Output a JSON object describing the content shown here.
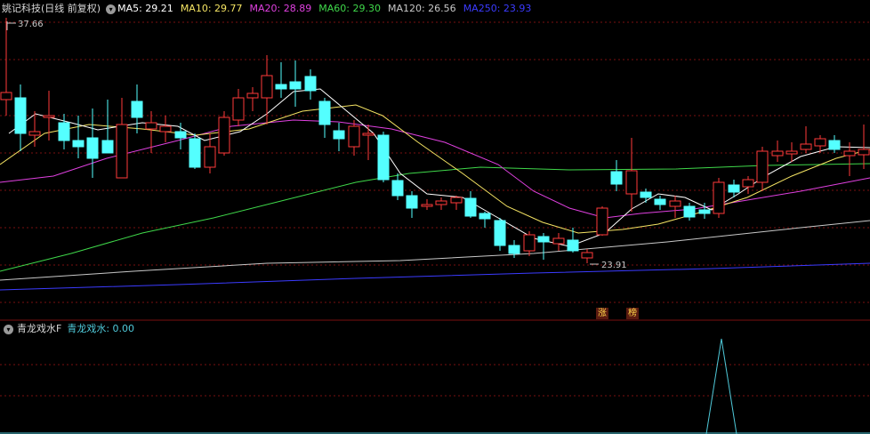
{
  "header": {
    "title": "姚记科技(日线 前复权)",
    "ma": [
      {
        "label": "MA5: 29.21",
        "color": "#ffffff"
      },
      {
        "label": "MA10: 29.77",
        "color": "#f5e463"
      },
      {
        "label": "MA20: 28.89",
        "color": "#e040e0"
      },
      {
        "label": "MA60: 29.30",
        "color": "#3fd84a"
      },
      {
        "label": "MA120: 26.56",
        "color": "#c8c8c8"
      },
      {
        "label": "MA250: 23.93",
        "color": "#3b3bff"
      }
    ]
  },
  "annotations": {
    "high": "37.66",
    "low": "23.91"
  },
  "tags": [
    "涨",
    "榜"
  ],
  "indicator": {
    "name": "青龙戏水F",
    "value_label": "青龙戏水: 0.00"
  },
  "colors": {
    "up": "#ff3a3a",
    "down": "#54ffff",
    "grid": "#7a1010",
    "ma5": "#ffffff",
    "ma10": "#f5e463",
    "ma20": "#e040e0",
    "ma60": "#3fd84a",
    "ma120": "#c8c8c8",
    "ma250": "#3b3bff",
    "indicator": "#4fc9d9"
  },
  "icons": [
    "chevron-down-icon",
    "chevron-down-icon"
  ]
}
